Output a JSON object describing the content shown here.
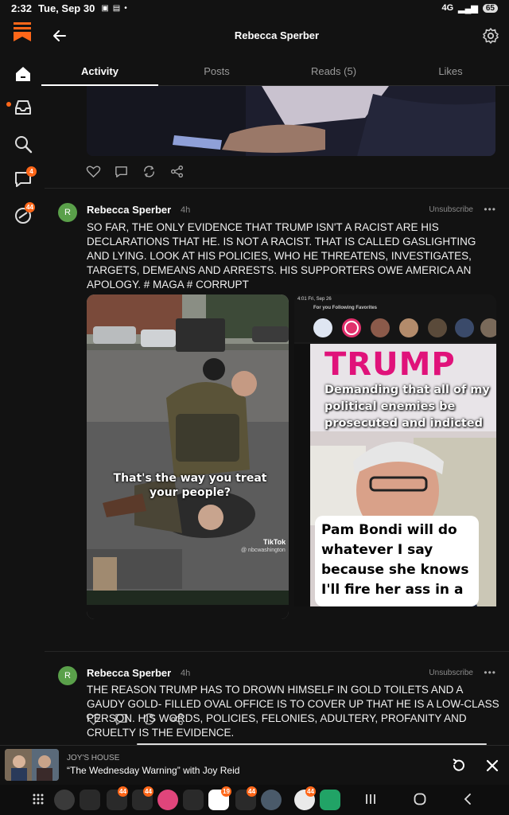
{
  "status": {
    "time": "2:32",
    "date": "Tue, Sep 30",
    "network": "4G",
    "battery": "65"
  },
  "header": {
    "title": "Rebecca Sperber"
  },
  "tabs": [
    {
      "label": "Activity"
    },
    {
      "label": "Posts"
    },
    {
      "label": "Reads (5)"
    },
    {
      "label": "Likes"
    }
  ],
  "rail": {
    "chat_badge": "4",
    "activity_badge": "44"
  },
  "posts": [
    {
      "avatar": "R",
      "author": "Rebecca Sperber",
      "ago": "4h",
      "unsubscribe": "Unsubscribe",
      "more": "•••",
      "text": "SO FAR, THE ONLY EVIDENCE THAT TRUMP ISN'T A RACIST ARE HIS DECLARATIONS THAT HE. IS NOT A RACIST. THAT IS CALLED GASLIGHTING AND LYING. LOOK AT HIS POLICIES, WHO HE THREATENS, INVESTIGATES, TARGETS, DEMEANS AND ARRESTS. HIS SUPPORTERS OWE AMERICA AN APOLOGY. # MAGA # CORRUPT",
      "image1_caption": "That's the way you treat your people?",
      "image1_watermark": "TikTok",
      "image1_handle": "@ nbcwashington",
      "image2_time": "4:01 Fri, Sep 26",
      "image2_tabs": "For you  Following  Favorites",
      "image2_headline": "TRUMP",
      "image2_subhead": "Demanding that all of my political enemies be prosecuted and indicted",
      "image2_quote": "Pam Bondi will do whatever I say because she knows I'll fire her ass in a"
    },
    {
      "avatar": "R",
      "author": "Rebecca Sperber",
      "ago": "4h",
      "unsubscribe": "Unsubscribe",
      "more": "•••",
      "text": "THE REASON TRUMP HAS TO DROWN HIMSELF IN GOLD TOILETS AND A GAUDY GOLD- FILLED OVAL OFFICE IS TO COVER UP THAT HE IS A LOW-CLASS PERSON. HIS WORDS, POLICIES, FELONIES, ADULTERY, PROFANITY AND CRUELTY IS THE EVIDENCE."
    }
  ],
  "player": {
    "show": "JOY'S HOUSE",
    "episode": "“The Wednesday Warning” with Joy Reid"
  },
  "taskbar": {
    "badges": [
      "44",
      "44",
      "19",
      "44",
      "44"
    ]
  },
  "colors": {
    "accent": "#ff6719",
    "background": "#121212",
    "avatar": "#5aa04a"
  }
}
